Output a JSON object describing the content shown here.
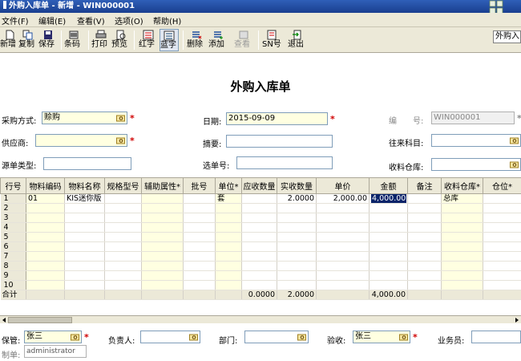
{
  "window": {
    "title": "外购入库单 - 新增 - WIN000001"
  },
  "menu": [
    "文件(F)",
    "编辑(E)",
    "查看(V)",
    "选项(O)",
    "帮助(H)"
  ],
  "toolbar": {
    "items": [
      {
        "label": "新增",
        "icon": "new-doc-icon"
      },
      {
        "label": "复制",
        "icon": "copy-icon"
      },
      {
        "label": "保存",
        "icon": "save-icon"
      },
      {
        "label": "条码",
        "icon": "barcode-icon"
      },
      {
        "label": "打印",
        "icon": "print-icon"
      },
      {
        "label": "预览",
        "icon": "preview-icon"
      },
      {
        "label": "红字",
        "icon": "red-text-icon"
      },
      {
        "label": "蓝字",
        "icon": "blue-text-icon"
      },
      {
        "label": "删除",
        "icon": "delete-row-icon"
      },
      {
        "label": "添加",
        "icon": "add-row-icon"
      },
      {
        "label": "查看",
        "icon": "view-icon"
      },
      {
        "label": "SN号",
        "icon": "sn-icon"
      },
      {
        "label": "退出",
        "icon": "exit-icon"
      }
    ],
    "right_text": "外购入"
  },
  "form": {
    "title": "外购入库单",
    "purchase_mode_label": "采购方式:",
    "purchase_mode_value": "赊购",
    "supplier_label": "供应商:",
    "supplier_value": "",
    "source_type_label": "源单类型:",
    "source_type_value": "",
    "date_label": "日期:",
    "date_value": "2015-09-09",
    "summary_label": "摘要:",
    "summary_value": "",
    "select_no_label": "选单号:",
    "select_no_value": "",
    "number_label": "编　　号:",
    "number_value": "WIN000001",
    "account_label": "往来科目:",
    "account_value": "",
    "warehouse_label": "收料仓库:",
    "warehouse_value": ""
  },
  "grid": {
    "columns": [
      "行号",
      "物料编码",
      "物料名称",
      "规格型号",
      "辅助属性*",
      "批号",
      "单位*",
      "应收数量",
      "实收数量",
      "单价",
      "金额",
      "备注",
      "收料仓库*",
      "仓位*"
    ],
    "rows": [
      [
        "1",
        "01",
        "KIS迷你版",
        "",
        "",
        "",
        "套",
        "",
        "2.0000",
        "2,000.00",
        "4,000.00",
        "",
        "总库",
        ""
      ],
      [
        "2",
        "",
        "",
        "",
        "",
        "",
        "",
        "",
        "",
        "",
        "",
        "",
        "",
        ""
      ],
      [
        "3",
        "",
        "",
        "",
        "",
        "",
        "",
        "",
        "",
        "",
        "",
        "",
        "",
        ""
      ],
      [
        "4",
        "",
        "",
        "",
        "",
        "",
        "",
        "",
        "",
        "",
        "",
        "",
        "",
        ""
      ],
      [
        "5",
        "",
        "",
        "",
        "",
        "",
        "",
        "",
        "",
        "",
        "",
        "",
        "",
        ""
      ],
      [
        "6",
        "",
        "",
        "",
        "",
        "",
        "",
        "",
        "",
        "",
        "",
        "",
        "",
        ""
      ],
      [
        "7",
        "",
        "",
        "",
        "",
        "",
        "",
        "",
        "",
        "",
        "",
        "",
        "",
        ""
      ],
      [
        "8",
        "",
        "",
        "",
        "",
        "",
        "",
        "",
        "",
        "",
        "",
        "",
        "",
        ""
      ],
      [
        "9",
        "",
        "",
        "",
        "",
        "",
        "",
        "",
        "",
        "",
        "",
        "",
        "",
        ""
      ],
      [
        "10",
        "",
        "",
        "",
        "",
        "",
        "",
        "",
        "",
        "",
        "",
        "",
        "",
        ""
      ]
    ],
    "total": [
      "合计",
      "",
      "",
      "",
      "",
      "",
      "",
      "0.0000",
      "2.0000",
      "",
      "4,000.00",
      "",
      "",
      ""
    ]
  },
  "footer": {
    "keeper_label": "保管:",
    "keeper_value": "张三",
    "responsible_label": "负责人:",
    "responsible_value": "",
    "dept_label": "部门:",
    "dept_value": "",
    "inspect_label": "验收:",
    "inspect_value": "张三",
    "salesman_label": "业务员:",
    "salesman_value": "",
    "maker_label": "制单:",
    "maker_value": "administrator"
  },
  "colors": {
    "title_bar": "#1a3f8f",
    "required": "#d00000",
    "required_field_bg": "#ffffe1",
    "selection": "#0a246a"
  }
}
